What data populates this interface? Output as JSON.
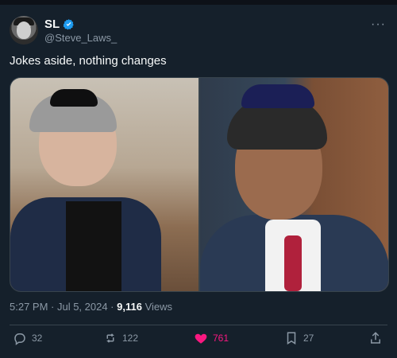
{
  "post": {
    "author_name": "SL",
    "handle": "@Steve_Laws_",
    "more_label": "···",
    "text": "Jokes aside, nothing changes",
    "time": "5:27 PM · Jul 5, 2024 ·",
    "views_count": "9,116",
    "views_label": "Views"
  },
  "actions": {
    "reply_count": "32",
    "repost_count": "122",
    "like_count": "761",
    "bookmark_count": "27"
  },
  "icons": {
    "verified": "verified-badge-icon",
    "reply": "reply-icon",
    "repost": "repost-icon",
    "like": "heart-icon",
    "bookmark": "bookmark-icon",
    "share": "share-icon"
  },
  "colors": {
    "background": "#15202b",
    "text": "#f7f9f9",
    "muted": "#8b98a5",
    "accent": "#1d9bf0",
    "like": "#f91880",
    "border": "#38444d"
  }
}
